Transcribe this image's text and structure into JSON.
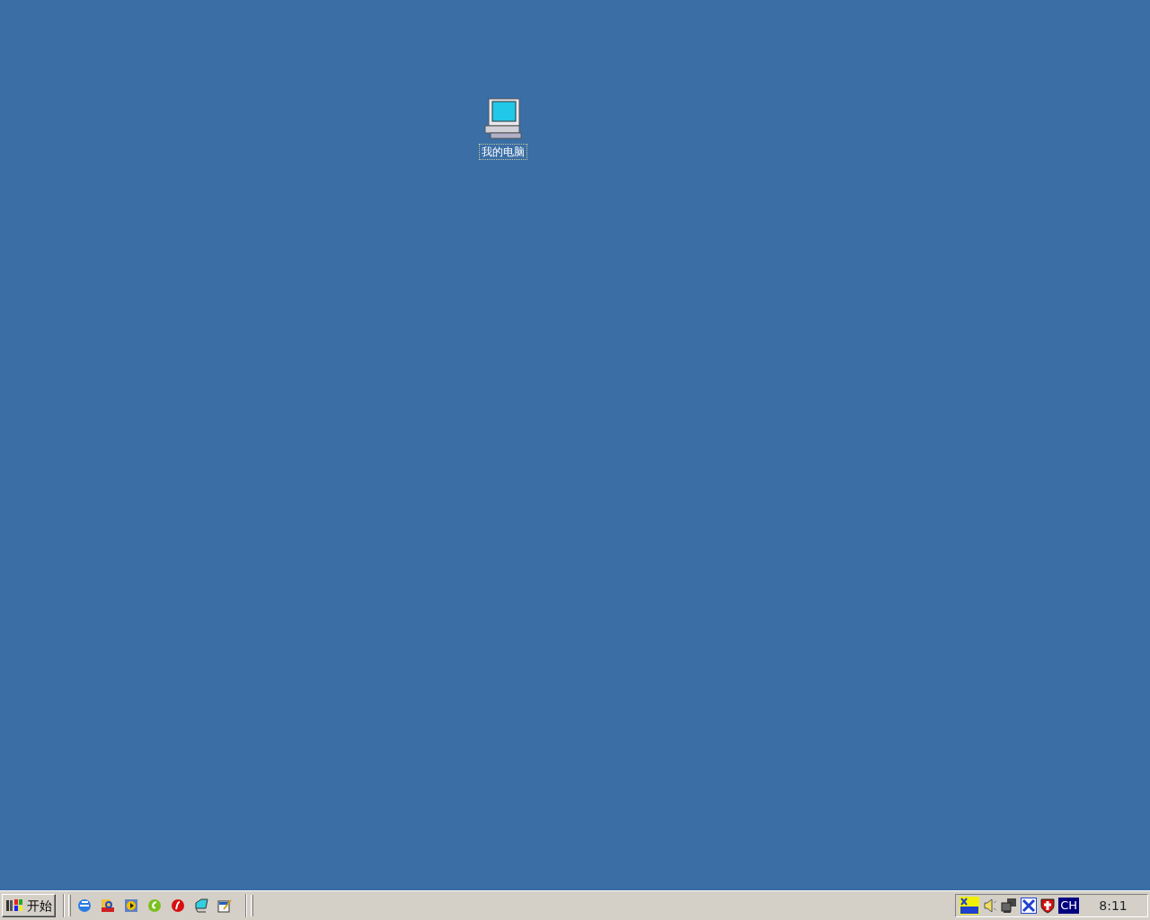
{
  "desktop": {
    "icons": [
      {
        "label": "我的电脑",
        "focused": true
      }
    ]
  },
  "taskbar": {
    "start_button": {
      "label": "开始"
    },
    "tray": {
      "language": "CH",
      "clock": "8:11"
    }
  }
}
